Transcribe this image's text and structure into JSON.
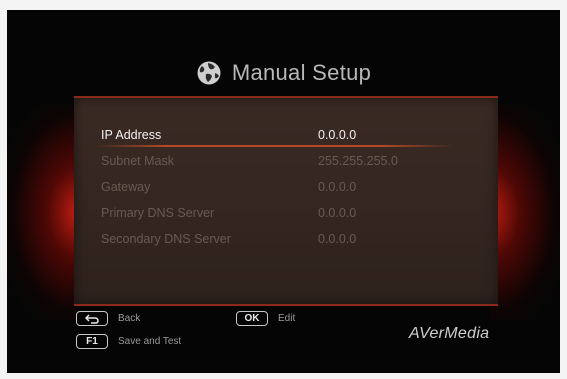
{
  "title": "Manual Setup",
  "icons": {
    "title": "globe-icon",
    "back": "return-arrow-icon"
  },
  "fields": [
    {
      "label": "IP Address",
      "value": "0.0.0.0"
    },
    {
      "label": "Subnet Mask",
      "value": "255.255.255.0"
    },
    {
      "label": "Gateway",
      "value": "0.0.0.0"
    },
    {
      "label": "Primary DNS Server",
      "value": "0.0.0.0"
    },
    {
      "label": "Secondary DNS Server",
      "value": "0.0.0.0"
    }
  ],
  "selected_field": "IP Address",
  "footer": {
    "back": {
      "label": "Back"
    },
    "ok": {
      "key": "OK",
      "label": "Edit"
    },
    "f1": {
      "key": "F1",
      "label": "Save and Test"
    }
  },
  "brand": "AVerMedia",
  "colors": {
    "accent_glow": "#c81e14",
    "selected_text": "#f2f2f2",
    "dim_text": "#6a5a52",
    "panel_border": "#8a2a1a"
  }
}
